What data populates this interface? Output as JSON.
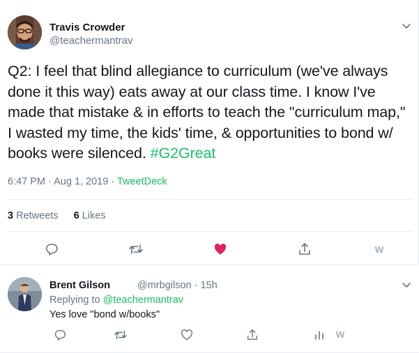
{
  "tweet": {
    "author_name": "Travis Crowder",
    "author_handle": "@teachermantrav",
    "text_before_hashtag": "Q2: I feel that blind allegiance to curriculum (we've always done it this way) eats away at our class time. I know I've made that mistake & in efforts to teach the \"curriculum map,\" I wasted my time, the kids' time, & opportunities to bond w/ books were silenced. ",
    "hashtag": "#G2Great",
    "timestamp": "6:47 PM · Aug 1, 2019 · ",
    "source": "TweetDeck",
    "retweets_count": "3",
    "retweets_label": "Retweets",
    "likes_count": "6",
    "likes_label": "Likes"
  },
  "reply": {
    "author_name": "Brent Gilson",
    "author_handle_time": "@mrbgilson · 15h",
    "replying_prefix": "Replying to ",
    "replying_to": "@teachermantrav",
    "text": "Yes love \"bond w/books\""
  },
  "icons": {
    "main_actions": [
      "reply-icon",
      "retweet-icon",
      "like-icon-filled",
      "share-icon",
      "w-icon"
    ],
    "reply_actions": [
      "reply-icon",
      "retweet-icon",
      "like-icon",
      "share-icon",
      "analytics-icon",
      "w-icon"
    ],
    "w_label": "W"
  },
  "colors": {
    "accent": "#17bf63",
    "like": "#e0245e",
    "muted": "#657786",
    "icon": "#657786"
  }
}
